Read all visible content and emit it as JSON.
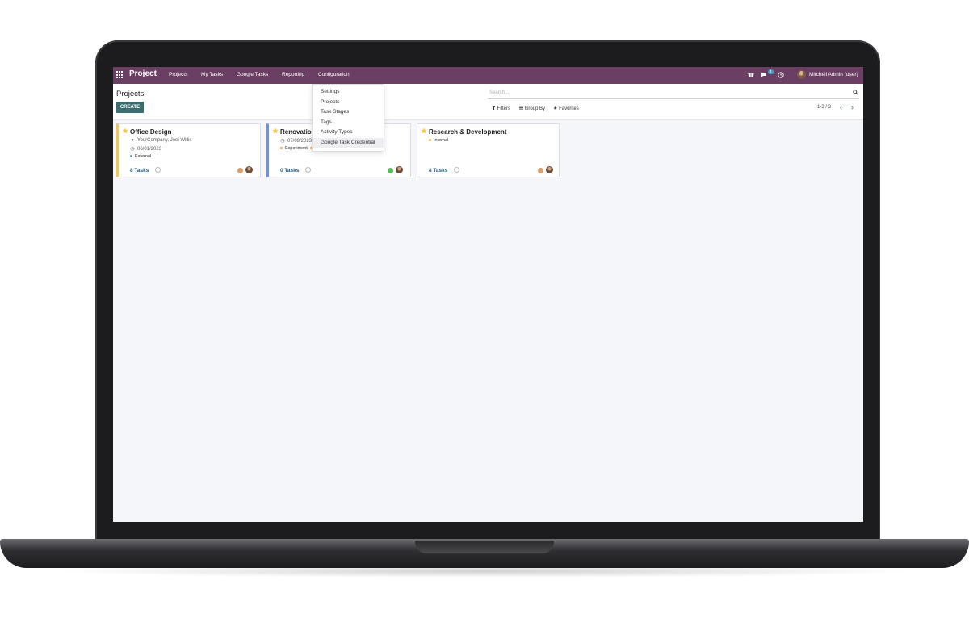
{
  "navbar": {
    "brand": "Project",
    "menus": [
      "Projects",
      "My Tasks",
      "Google Tasks",
      "Reporting",
      "Configuration"
    ],
    "messages_badge": "4",
    "user": "Mitchell Admin (user)"
  },
  "configuration_menu": {
    "items": [
      "Settings",
      "Projects",
      "Task Stages",
      "Tags",
      "Activity Types",
      "Google Task Credential"
    ],
    "highlighted": "Google Task Credential"
  },
  "control_panel": {
    "title": "Projects",
    "create_label": "CREATE",
    "search_placeholder": "Search...",
    "filters_label": "Filters",
    "group_by_label": "Group By",
    "favorites_label": "Favorites",
    "pager": "1-3 / 3"
  },
  "cards": [
    {
      "title": "Office Design",
      "customer": "YourCompany, Joel Willis",
      "date": "06/01/2023",
      "tags": [
        {
          "label": "External",
          "color": "#6b8fd6"
        }
      ],
      "tasks": "8 Tasks",
      "status_color": "#d7a06c",
      "favorite": true,
      "bar_color": "#f2c94c"
    },
    {
      "title": "Renovation",
      "customer": "",
      "date": "07/09/2023",
      "tags": [
        {
          "label": "Experiment",
          "color": "#f0a04b"
        },
        {
          "label": "",
          "color": "#f0a04b"
        }
      ],
      "tasks": "0 Tasks",
      "status_color": "#5cb85c",
      "favorite": true,
      "bar_color": "#6f93d6"
    },
    {
      "title": "Research & Development",
      "customer": "",
      "date": "",
      "tags": [
        {
          "label": "Internal",
          "color": "#f0a04b"
        }
      ],
      "tasks": "8 Tasks",
      "status_color": "#d7a06c",
      "favorite": true,
      "bar_color": ""
    }
  ],
  "colors": {
    "navbar": "#6b3f63",
    "primary_button": "#3a6d70",
    "star": "#f2c94c",
    "link": "#1c5a87"
  }
}
